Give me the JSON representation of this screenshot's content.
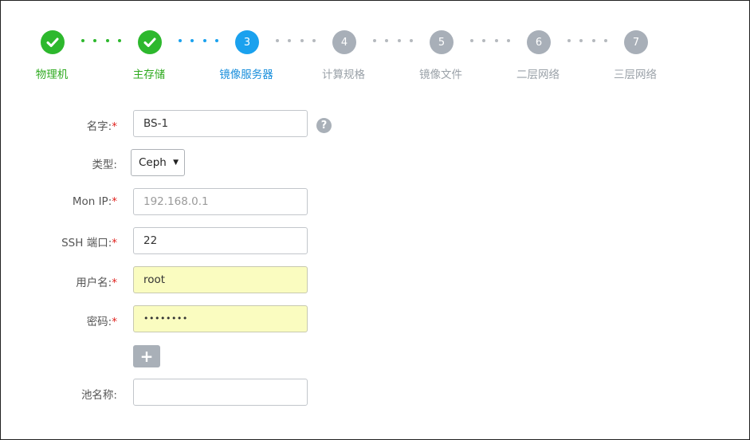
{
  "steps": [
    {
      "label": "物理机",
      "status": "done",
      "number": ""
    },
    {
      "label": "主存储",
      "status": "done",
      "number": ""
    },
    {
      "label": "镜像服务器",
      "status": "active",
      "number": "3"
    },
    {
      "label": "计算规格",
      "status": "todo",
      "number": "4"
    },
    {
      "label": "镜像文件",
      "status": "todo",
      "number": "5"
    },
    {
      "label": "二层网络",
      "status": "todo",
      "number": "6"
    },
    {
      "label": "三层网络",
      "status": "todo",
      "number": "7"
    }
  ],
  "colors": {
    "done": "#2db82d",
    "active": "#1aa1ee",
    "todo": "#a8afb8",
    "required": "#e0211d",
    "autofill": "#fafcc0"
  },
  "form": {
    "name": {
      "label": "名字:",
      "required": "*",
      "value": "BS-1"
    },
    "type": {
      "label": "类型:",
      "selected": "Ceph"
    },
    "mon_ip": {
      "label": "Mon IP:",
      "required": "*",
      "placeholder": "192.168.0.1"
    },
    "ssh_port": {
      "label": "SSH 端口:",
      "required": "*",
      "value": "22"
    },
    "username": {
      "label": "用户名:",
      "required": "*",
      "value": "root"
    },
    "password": {
      "label": "密码:",
      "required": "*",
      "value": "••••••••"
    },
    "add_button": "+",
    "pool_name": {
      "label": "池名称:",
      "value": ""
    }
  },
  "help_icon": "?"
}
